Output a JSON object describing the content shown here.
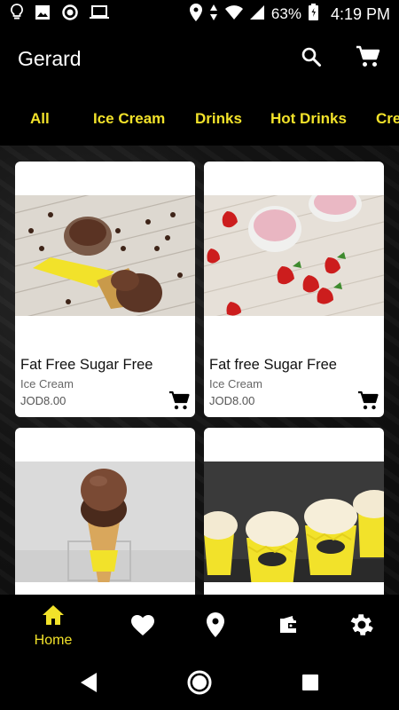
{
  "status_bar": {
    "battery": "63%",
    "time": "4:19 PM"
  },
  "app_bar": {
    "title": "Gerard",
    "icons": [
      "search-icon",
      "cart-icon"
    ]
  },
  "tabs": [
    {
      "label": "All",
      "selected": true
    },
    {
      "label": "Ice Cream",
      "selected": false
    },
    {
      "label": "Drinks",
      "selected": false
    },
    {
      "label": "Hot Drinks",
      "selected": false
    },
    {
      "label": "Cre",
      "selected": false
    }
  ],
  "products": [
    {
      "name": "Fat Free Sugar Free",
      "category": "Ice Cream",
      "price": "JOD8.00",
      "image": "chocolate-ice-cream-cone"
    },
    {
      "name": "Fat free Sugar Free",
      "category": "Ice Cream",
      "price": "JOD8.00",
      "image": "strawberry-ice-cream-cup"
    },
    {
      "name": "",
      "category": "",
      "price": "",
      "image": "chocolate-scoop-cone"
    },
    {
      "name": "",
      "category": "",
      "price": "",
      "image": "vanilla-ice-cream-cups"
    }
  ],
  "bottom_nav": {
    "items": [
      {
        "label": "Home",
        "icon": "home-icon",
        "active": true
      },
      {
        "label": "",
        "icon": "heart-icon",
        "active": false
      },
      {
        "label": "",
        "icon": "location-pin-icon",
        "active": false
      },
      {
        "label": "",
        "icon": "wallet-icon",
        "active": false
      },
      {
        "label": "",
        "icon": "gear-icon",
        "active": false
      }
    ]
  },
  "colors": {
    "accent": "#f2e22a",
    "background": "#000000",
    "card": "#ffffff"
  }
}
